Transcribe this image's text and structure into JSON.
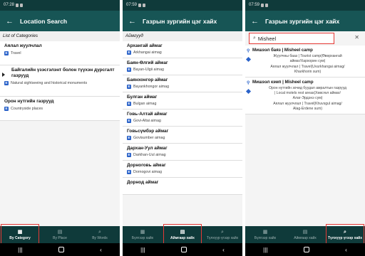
{
  "panel1": {
    "time": "07:28",
    "title": "Location Search",
    "section_label": "List of Categories",
    "categories": [
      {
        "name": "Аялал жуулчлал",
        "sub": "Travel"
      },
      {
        "name": "Байгалийн үзэсгэлэнт болон түүхэн дурсгалт газрууд",
        "sub": "Natural sightseeing and historical monuments"
      },
      {
        "name": "Орон нутгийн газрууд",
        "sub": "Countryside places"
      }
    ],
    "nav": [
      "By Category",
      "By Place",
      "By Words"
    ]
  },
  "panel2": {
    "time": "07:59",
    "title": "Газрын зургийн цэг хайх",
    "section_label": "Аймгууд",
    "places": [
      {
        "name": "Архангай аймаг",
        "sub": "Arkhangai aimag"
      },
      {
        "name": "Баян-Өлгий аймаг",
        "sub": "Bayan-Ulgii aimag"
      },
      {
        "name": "Баянхонгор аймаг",
        "sub": "Bayankhongor aimag"
      },
      {
        "name": "Булган аймаг",
        "sub": "Bulgan aimag"
      },
      {
        "name": "Говь-Алтай аймаг",
        "sub": "Govi-Altai aimag"
      },
      {
        "name": "Говьсүмбэр аймаг",
        "sub": "Govisumber aimag"
      },
      {
        "name": "Дархан-Уул аймаг",
        "sub": "Darkhan-Uul aimag"
      },
      {
        "name": "Дорноговь аймаг",
        "sub": "Dornogovi aimag"
      },
      {
        "name": "Дорнод аймаг",
        "sub": ""
      }
    ],
    "nav": [
      "Бүлгээр хайх",
      "Аймгаар хайх",
      "Түлхүүр үгээр хайх"
    ]
  },
  "panel3": {
    "time": "07:59",
    "title": "Газрын зургийн цэг хайх",
    "search_value": "Misheel",
    "results": [
      {
        "name": "Мишээл баяз | Misheel camp",
        "lines": [
          "Жуулчны бааз | Tourist camp(Өвөрхангай",
          "аймаг/Хархорин сум)",
          "Аялал жуулчлал | Travel(Uvurkhangai aimag/",
          "Kharkhorin sum)"
        ]
      },
      {
        "name": "Мишээл кэмп | Misheel camp",
        "lines": [
          "Орон нутгийн зочид буудал амралтын газрууд",
          "| Local motels rest areas(Хөвсгөл аймаг/",
          "Алаг-Эрдэнэ сум)",
          "Аялал жуулчлал | Travel(Khuvsgul aimag/",
          "Alag-Erdene sum)"
        ]
      }
    ],
    "nav": [
      "Бүлгээр хайх",
      "Аймгаар хайх",
      "Түлхүүр үгээр хайх"
    ]
  },
  "colors": {
    "appbar": "#175555",
    "nav": "#0f3a3a",
    "highlight": "#e53935",
    "badge": "#2a62c9"
  }
}
